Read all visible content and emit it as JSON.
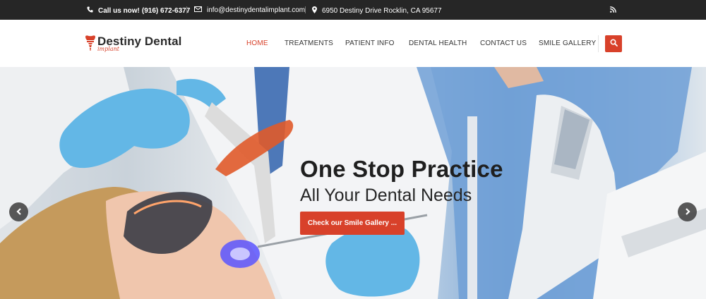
{
  "topbar": {
    "call_label": "Call us now!",
    "phone": "(916) 672-6377",
    "email": "info@destinydentalimplant.com",
    "address": "6950 Destiny Drive Rocklin, CA 95677",
    "icons": [
      "phone-icon",
      "envelope-icon",
      "map-marker-icon",
      "rss-icon"
    ]
  },
  "logo": {
    "name": "Destiny Dental",
    "sub": "implant"
  },
  "nav": {
    "items": [
      {
        "label": "HOME",
        "active": true
      },
      {
        "label": "TREATMENTS",
        "active": false
      },
      {
        "label": "PATIENT INFO",
        "active": false
      },
      {
        "label": "DENTAL HEALTH",
        "active": false
      },
      {
        "label": "CONTACT US",
        "active": false
      },
      {
        "label": "SMILE GALLERY",
        "active": false
      }
    ]
  },
  "hero": {
    "title": "One Stop Practice",
    "subtitle": "All Your Dental Needs",
    "cta_label": "Check our Smile Gallery ..."
  },
  "colors": {
    "accent": "#d8412a",
    "topbar_bg": "#262626",
    "text_dark": "#1f1f1f"
  }
}
